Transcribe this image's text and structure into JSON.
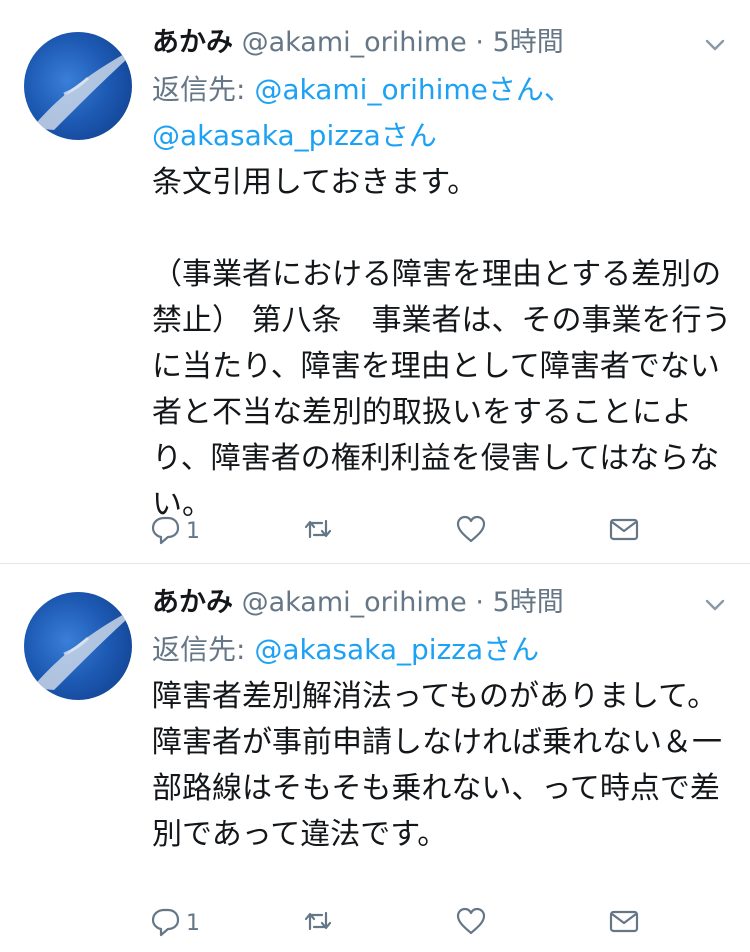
{
  "tweets": [
    {
      "name": "あかみ",
      "handle": "@akami_orihime",
      "dot": "·",
      "time": "5時間",
      "reply_prefix": "返信先: ",
      "mentions_line1": "@akami_orihimeさん、",
      "mentions_line2": "@akasaka_pizzaさん",
      "text": "条文引用しておきます。\n\n（事業者における障害を理由とする差別の禁止） 第八条　事業者は、その事業を行うに当たり、障害を理由として障害者でない者と不当な差別的取扱いをすることにより、障害者の権利利益を侵害してはならない。",
      "reply_count": "1"
    },
    {
      "name": "あかみ",
      "handle": "@akami_orihime",
      "dot": "·",
      "time": "5時間",
      "reply_prefix": "返信先: ",
      "mentions_line1": "@akasaka_pizzaさん",
      "text": "障害者差別解消法ってものがありまして。\n障害者が事前申請しなければ乗れない＆一部路線はそもそも乗れない、って時点で差別であって違法です。",
      "reply_count": "1"
    }
  ],
  "icons": [
    "avatar",
    "chevron-down-icon",
    "reply-icon",
    "retweet-icon",
    "like-icon",
    "dm-icon"
  ],
  "colors": {
    "accent": "#1da1f2",
    "muted": "#657786",
    "text": "#14171a",
    "divider": "#e1e8ed"
  }
}
